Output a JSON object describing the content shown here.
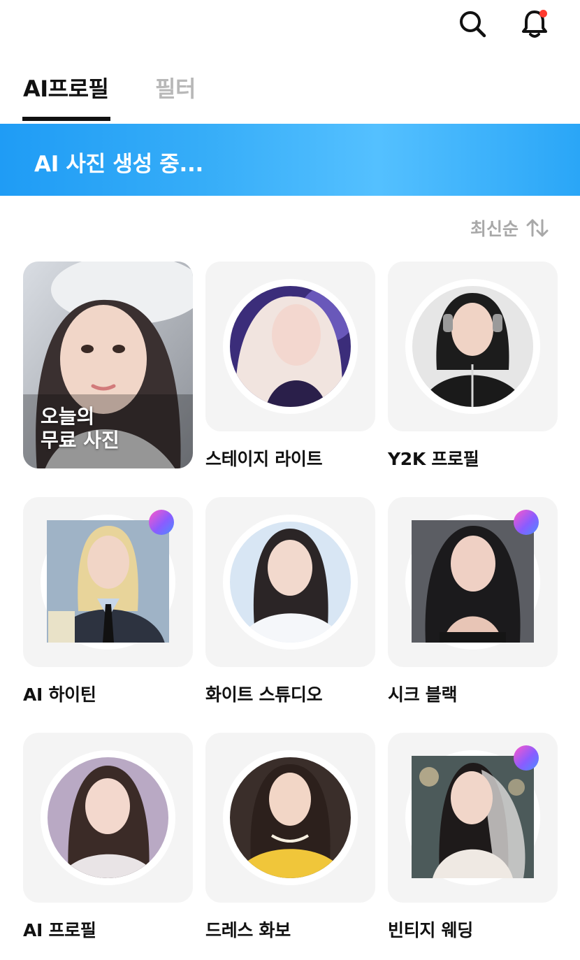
{
  "header": {
    "search_icon": "search-icon",
    "bell_icon": "bell-icon",
    "notification_dot_color": "#ff3b30"
  },
  "tabs": [
    {
      "label": "AI프로필",
      "active": true
    },
    {
      "label": "필터",
      "active": false
    }
  ],
  "banner": {
    "text": "AI 사진 생성 중..."
  },
  "sort": {
    "label": "최신순",
    "icon": "sort-arrows-icon"
  },
  "free_card": {
    "text_line1": "오늘의",
    "text_line2": "무료 사진"
  },
  "cards": [
    {
      "title": "스테이지 라이트",
      "shape": "circle"
    },
    {
      "title": "Y2K 프로필",
      "shape": "circle"
    },
    {
      "title": "AI 하이틴",
      "shape": "square",
      "new_badge": true
    },
    {
      "title": "화이트 스튜디오",
      "shape": "circle"
    },
    {
      "title": "시크 블랙",
      "shape": "square",
      "new_badge": true
    },
    {
      "title": "AI 프로필",
      "shape": "circle"
    },
    {
      "title": "드레스 화보",
      "shape": "circle"
    },
    {
      "title": "빈티지 웨딩",
      "shape": "square",
      "new_badge": true
    }
  ],
  "colors": {
    "accent_blue": "#2aa6f7",
    "card_bg": "#f4f4f4",
    "inactive_tab": "#b8b8b8"
  }
}
